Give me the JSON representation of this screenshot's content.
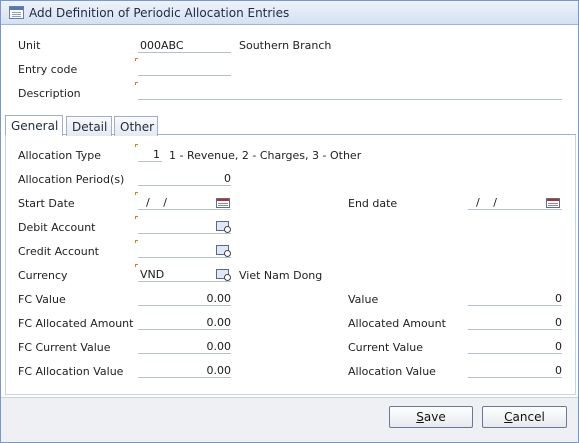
{
  "window": {
    "title": "Add Definition of Periodic Allocation Entries"
  },
  "header": {
    "unit": {
      "label": "Unit",
      "value": "000ABC",
      "name": "Southern Branch"
    },
    "entry_code": {
      "label": "Entry code",
      "value": ""
    },
    "description": {
      "label": "Description",
      "value": ""
    }
  },
  "tabs": [
    {
      "label": "General",
      "active": true
    },
    {
      "label": "Detail",
      "active": false
    },
    {
      "label": "Other",
      "active": false
    }
  ],
  "general": {
    "allocation_type": {
      "label": "Allocation Type",
      "value": "1",
      "hint": "1 - Revenue, 2 - Charges, 3 - Other"
    },
    "allocation_periods": {
      "label": "Allocation Period(s)",
      "value": "0"
    },
    "start_date": {
      "label": "Start Date",
      "value": "/ /"
    },
    "end_date": {
      "label": "End date",
      "value": "/ /"
    },
    "debit_account": {
      "label": "Debit Account",
      "value": ""
    },
    "credit_account": {
      "label": "Credit Account",
      "value": ""
    },
    "currency": {
      "label": "Currency",
      "value": "VND",
      "name": "Viet Nam Dong"
    },
    "fc_value": {
      "label": "FC Value",
      "value": "0.00"
    },
    "value": {
      "label": "Value",
      "value": "0"
    },
    "fc_allocated_amount": {
      "label": "FC Allocated Amount",
      "value": "0.00"
    },
    "allocated_amount": {
      "label": "Allocated Amount",
      "value": "0"
    },
    "fc_current_value": {
      "label": "FC Current Value",
      "value": "0.00"
    },
    "current_value": {
      "label": "Current Value",
      "value": "0"
    },
    "fc_allocation_value": {
      "label": "FC Allocation Value",
      "value": "0.00"
    },
    "allocation_value": {
      "label": "Allocation Value",
      "value": "0"
    }
  },
  "buttons": {
    "save": {
      "label": "Save",
      "accel": "S",
      "rest": "ave"
    },
    "cancel": {
      "label": "Cancel",
      "accel": "C",
      "rest": "ancel"
    }
  },
  "colors": {
    "title_bar": "#d4e0f2",
    "required_marker": "#e0761d",
    "field_border": "#b5c0cf"
  }
}
